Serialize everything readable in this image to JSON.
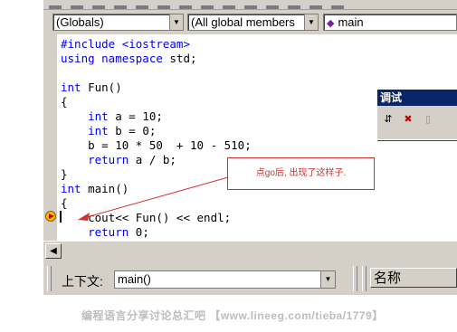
{
  "toolbar": {
    "class_combo": "(Globals)",
    "members_combo": "(All global members",
    "function_combo": "main"
  },
  "editor": {
    "lines": [
      [
        {
          "t": "#include <iostream>",
          "c": "kw"
        }
      ],
      [
        {
          "t": "using namespace ",
          "c": "kw"
        },
        {
          "t": "std;",
          "c": ""
        }
      ],
      [
        {
          "t": "",
          "c": ""
        }
      ],
      [
        {
          "t": "int",
          "c": "kw"
        },
        {
          "t": " Fun()",
          "c": ""
        }
      ],
      [
        {
          "t": "{",
          "c": ""
        }
      ],
      [
        {
          "t": "    ",
          "c": ""
        },
        {
          "t": "int",
          "c": "kw"
        },
        {
          "t": " a = 10;",
          "c": ""
        }
      ],
      [
        {
          "t": "    ",
          "c": ""
        },
        {
          "t": "int",
          "c": "kw"
        },
        {
          "t": " b = 0;",
          "c": ""
        }
      ],
      [
        {
          "t": "    b = 10 * 50  + 10 - 510;",
          "c": ""
        }
      ],
      [
        {
          "t": "    ",
          "c": ""
        },
        {
          "t": "return",
          "c": "kw"
        },
        {
          "t": " a / b;",
          "c": ""
        }
      ],
      [
        {
          "t": "}",
          "c": ""
        }
      ],
      [
        {
          "t": "int",
          "c": "kw"
        },
        {
          "t": " main()",
          "c": ""
        }
      ],
      [
        {
          "t": "{",
          "c": ""
        }
      ],
      [
        {
          "t": "    cout<< Fun() << endl;",
          "c": ""
        }
      ],
      [
        {
          "t": "    ",
          "c": ""
        },
        {
          "t": "return",
          "c": "kw"
        },
        {
          "t": " 0;",
          "c": ""
        }
      ]
    ]
  },
  "debug_toolbar": {
    "title": "调试"
  },
  "annotation": {
    "text": "点go后, 出现了这样子."
  },
  "context_bar": {
    "label": "上下文:",
    "value": "main()"
  },
  "variables_panel": {
    "header": "名称"
  },
  "watermark": "编程语言分享讨论总汇吧 【www.lineeg.com/tieba/1779】",
  "colors": {
    "keyword": "#0000ff",
    "annotation": "#d43030",
    "titlebar": "#0a246a"
  }
}
